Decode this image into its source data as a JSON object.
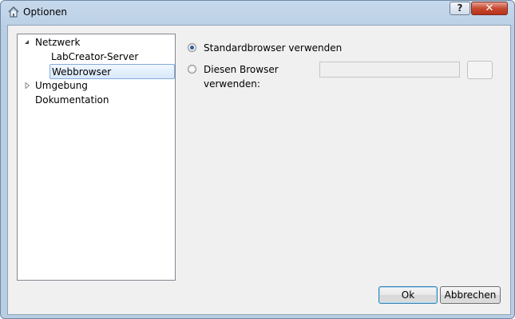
{
  "window": {
    "title": "Optionen",
    "help_label": "?",
    "close_label": "✕"
  },
  "tree": {
    "items": [
      {
        "label": "Netzwerk",
        "state": "expanded"
      },
      {
        "label": "LabCreator-Server"
      },
      {
        "label": "Webbrowser",
        "selected": true
      },
      {
        "label": "Umgebung",
        "state": "collapsed"
      },
      {
        "label": "Dokumentation"
      }
    ]
  },
  "browser": {
    "option_default": "Standardbrowser verwenden",
    "option_custom": "Diesen Browser verwenden:",
    "path_value": "",
    "browse_label": "",
    "selected_option": "default"
  },
  "buttons": {
    "ok": "Ok",
    "cancel": "Abbrechen"
  }
}
